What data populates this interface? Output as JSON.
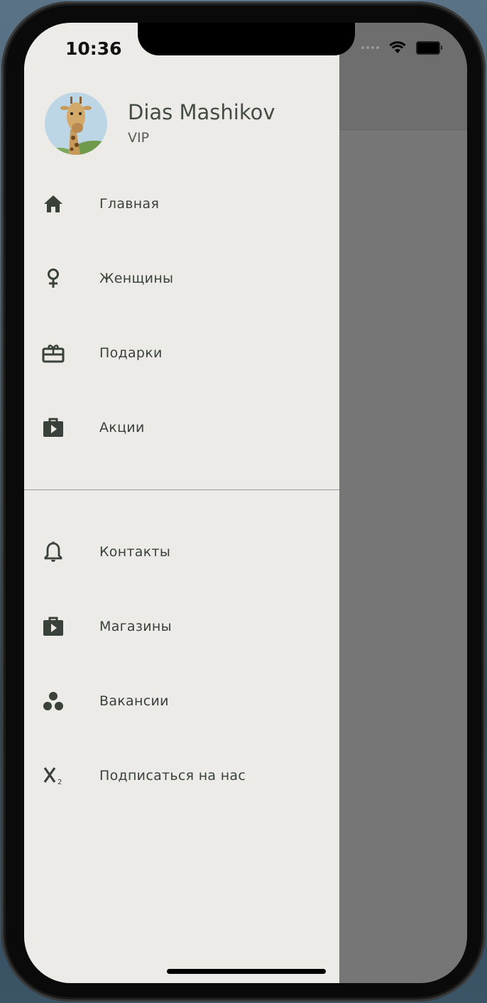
{
  "status_bar": {
    "time": "10:36"
  },
  "drawer": {
    "user": {
      "name": "Dias Mashikov",
      "status": "VIP",
      "avatar_icon": "giraffe-photo"
    },
    "primary_items": [
      {
        "label": "Главная",
        "icon": "home-icon"
      },
      {
        "label": "Женщины",
        "icon": "female-icon"
      },
      {
        "label": "Подарки",
        "icon": "gift-card-icon"
      },
      {
        "label": "Акции",
        "icon": "shop-icon"
      }
    ],
    "secondary_items": [
      {
        "label": "Контакты",
        "icon": "bell-icon"
      },
      {
        "label": "Магазины",
        "icon": "shop-icon"
      },
      {
        "label": "Вакансии",
        "icon": "bubble-chart-icon"
      },
      {
        "label": "Подписаться на нас",
        "icon": "subscript-icon"
      }
    ]
  },
  "colors": {
    "drawer_bg": "#edebe8",
    "scrim": "#767676",
    "icon": "#3a403a",
    "text": "#3a403a"
  }
}
